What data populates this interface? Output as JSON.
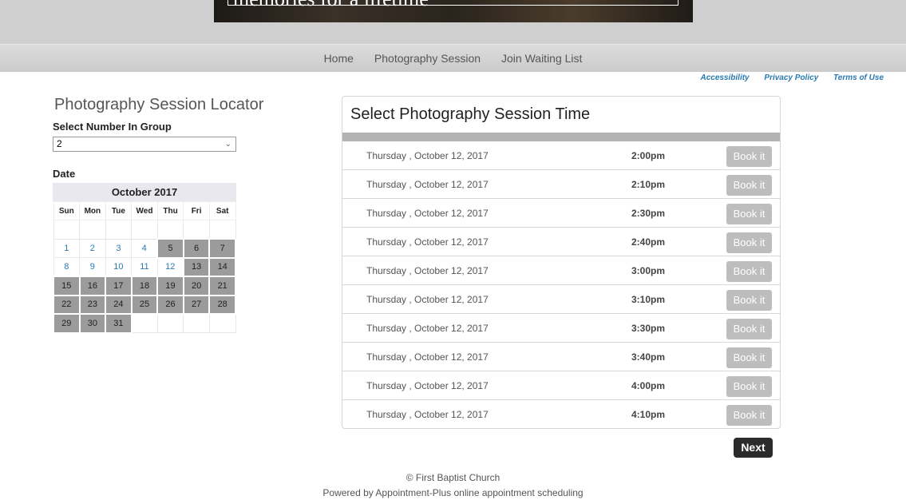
{
  "banner": {
    "text": "memories for a lifetime"
  },
  "nav": {
    "items": [
      "Home",
      "Photography Session",
      "Join Waiting List"
    ]
  },
  "util_links": [
    "Accessibility",
    "Privacy Policy",
    "Terms of Use"
  ],
  "locator": {
    "title": "Photography Session Locator",
    "group_label": "Select Number In Group",
    "group_value": "2",
    "date_label": "Date"
  },
  "calendar": {
    "month_label": "October 2017",
    "weekdays": [
      "Sun",
      "Mon",
      "Tue",
      "Wed",
      "Thu",
      "Fri",
      "Sat"
    ],
    "weeks": [
      [
        null,
        null,
        null,
        null,
        null,
        null,
        null
      ],
      [
        {
          "d": "1",
          "s": "avail"
        },
        {
          "d": "2",
          "s": "avail"
        },
        {
          "d": "3",
          "s": "avail"
        },
        {
          "d": "4",
          "s": "avail"
        },
        {
          "d": "5",
          "s": "unavail"
        },
        {
          "d": "6",
          "s": "unavail"
        },
        {
          "d": "7",
          "s": "unavail"
        }
      ],
      [
        {
          "d": "8",
          "s": "avail"
        },
        {
          "d": "9",
          "s": "avail"
        },
        {
          "d": "10",
          "s": "avail"
        },
        {
          "d": "11",
          "s": "avail"
        },
        {
          "d": "12",
          "s": "avail"
        },
        {
          "d": "13",
          "s": "unavail"
        },
        {
          "d": "14",
          "s": "unavail"
        }
      ],
      [
        {
          "d": "15",
          "s": "unavail"
        },
        {
          "d": "16",
          "s": "unavail"
        },
        {
          "d": "17",
          "s": "unavail"
        },
        {
          "d": "18",
          "s": "unavail"
        },
        {
          "d": "19",
          "s": "unavail"
        },
        {
          "d": "20",
          "s": "unavail"
        },
        {
          "d": "21",
          "s": "unavail"
        }
      ],
      [
        {
          "d": "22",
          "s": "unavail"
        },
        {
          "d": "23",
          "s": "unavail"
        },
        {
          "d": "24",
          "s": "unavail"
        },
        {
          "d": "25",
          "s": "unavail"
        },
        {
          "d": "26",
          "s": "unavail"
        },
        {
          "d": "27",
          "s": "unavail"
        },
        {
          "d": "28",
          "s": "unavail"
        }
      ],
      [
        {
          "d": "29",
          "s": "unavail"
        },
        {
          "d": "30",
          "s": "unavail"
        },
        {
          "d": "31",
          "s": "unavail"
        },
        null,
        null,
        null,
        null
      ]
    ]
  },
  "sessions": {
    "title": "Select Photography Session Time",
    "book_label": "Book it",
    "slots": [
      {
        "date": "Thursday , October 12, 2017",
        "time": "2:00pm"
      },
      {
        "date": "Thursday , October 12, 2017",
        "time": "2:10pm"
      },
      {
        "date": "Thursday , October 12, 2017",
        "time": "2:30pm"
      },
      {
        "date": "Thursday , October 12, 2017",
        "time": "2:40pm"
      },
      {
        "date": "Thursday , October 12, 2017",
        "time": "3:00pm"
      },
      {
        "date": "Thursday , October 12, 2017",
        "time": "3:10pm"
      },
      {
        "date": "Thursday , October 12, 2017",
        "time": "3:30pm"
      },
      {
        "date": "Thursday , October 12, 2017",
        "time": "3:40pm"
      },
      {
        "date": "Thursday , October 12, 2017",
        "time": "4:00pm"
      },
      {
        "date": "Thursday , October 12, 2017",
        "time": "4:10pm"
      }
    ]
  },
  "next_label": "Next",
  "footer": {
    "copyright": "© First Baptist Church",
    "powered": "Powered by Appointment-Plus online appointment scheduling"
  },
  "colors": {
    "link": "#2a7ab0",
    "unavailable_day": "#9b9b9b",
    "book_button": "#bdbdbd",
    "next_button": "#2b2b2b"
  }
}
